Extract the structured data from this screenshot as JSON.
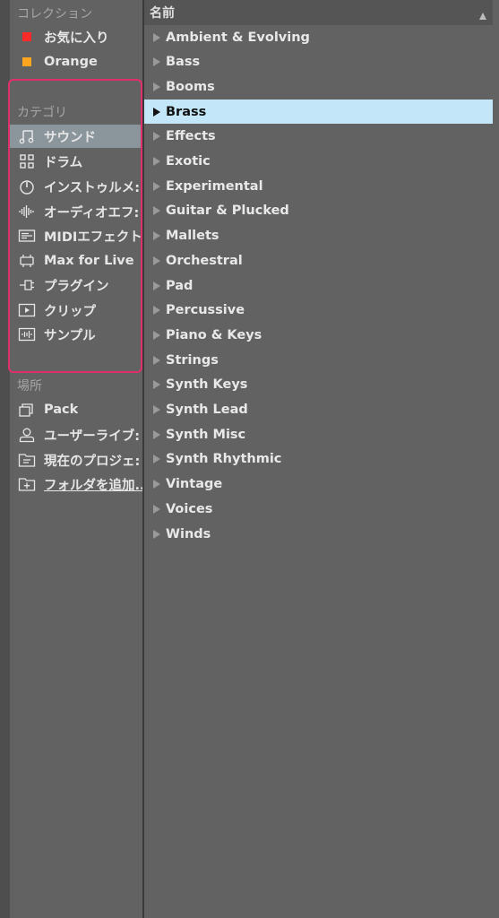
{
  "sidebar": {
    "collections_title": "コレクション",
    "collections": [
      {
        "label": "お気に入り",
        "color": "#ff2a2a"
      },
      {
        "label": "Orange",
        "color": "#ffa51f"
      }
    ],
    "categories_title": "カテゴリ",
    "categories": [
      {
        "label": "サウンド",
        "icon": "note-icon"
      },
      {
        "label": "ドラム",
        "icon": "grid-icon"
      },
      {
        "label": "インストゥルメ:",
        "icon": "power-icon"
      },
      {
        "label": "オーディオエフ:",
        "icon": "waveform-icon"
      },
      {
        "label": "MIDIエフェクト",
        "icon": "midi-icon"
      },
      {
        "label": "Max for Live",
        "icon": "max-icon"
      },
      {
        "label": "プラグイン",
        "icon": "plug-icon"
      },
      {
        "label": "クリップ",
        "icon": "clip-icon"
      },
      {
        "label": "サンプル",
        "icon": "sample-icon"
      }
    ],
    "places_title": "場所",
    "places": [
      {
        "label": "Pack",
        "icon": "pack-icon"
      },
      {
        "label": "ユーザーライブ:",
        "icon": "user-icon"
      },
      {
        "label": "現在のプロジェ:",
        "icon": "project-folder-icon"
      },
      {
        "label": "フォルダを追加..",
        "icon": "add-folder-icon"
      }
    ]
  },
  "main": {
    "header_label": "名前",
    "items": [
      "Ambient & Evolving",
      "Bass",
      "Booms",
      "Brass",
      "Effects",
      "Exotic",
      "Experimental",
      "Guitar & Plucked",
      "Mallets",
      "Orchestral",
      "Pad",
      "Percussive",
      "Piano & Keys",
      "Strings",
      "Synth Keys",
      "Synth Lead",
      "Synth Misc",
      "Synth Rhythmic",
      "Vintage",
      "Voices",
      "Winds"
    ],
    "selected_item": "Brass"
  },
  "colors": {
    "highlight_border": "#e0306a",
    "selected_row": "#c3e7f8",
    "selected_sidebar": "#8b959c"
  }
}
